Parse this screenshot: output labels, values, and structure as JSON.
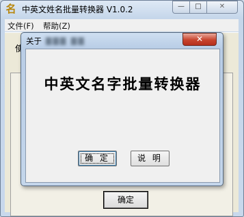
{
  "window": {
    "title": "中英文姓名批量转换器 V1.0.2",
    "icon": "名",
    "controls": {
      "minimize": "—",
      "maximize": "□",
      "close": "✕"
    }
  },
  "menu": {
    "file": "文件(F)",
    "help": "帮助(Z)"
  },
  "main": {
    "partial_label": "使",
    "ok_button": "确定"
  },
  "about_dialog": {
    "title": "关于",
    "close_symbol": "✕",
    "headline": "中英文名字批量转换器",
    "ok_button": "确 定",
    "help_button": "说 明"
  },
  "colors": {
    "close_button": "#c8442e",
    "title_gradient_top": "#dfe9f5",
    "dialog_bg": "#f0f0f0"
  }
}
